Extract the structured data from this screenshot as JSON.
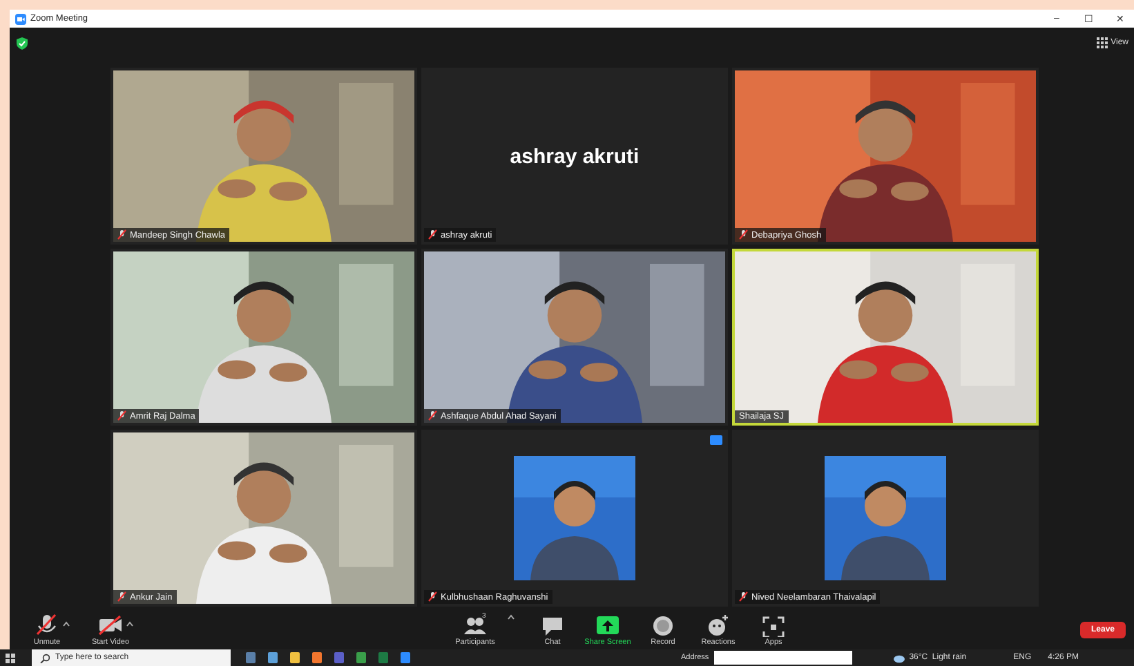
{
  "window": {
    "title": "Zoom Meeting",
    "controls": [
      "–",
      "☐",
      "✕"
    ]
  },
  "top_bar": {
    "view_label": "View"
  },
  "tiles": [
    {
      "kind": "video",
      "name": "Mandeep Singh Chawla",
      "muted": true,
      "speaking": false
    },
    {
      "kind": "name",
      "name": "ashray akruti",
      "display": "ashray akruti",
      "muted": true,
      "speaking": false
    },
    {
      "kind": "video",
      "name": "Debapriya Ghosh",
      "muted": true,
      "speaking": false
    },
    {
      "kind": "video",
      "name": "Amrit Raj Dalma",
      "muted": true,
      "speaking": false
    },
    {
      "kind": "video",
      "name": "Ashfaque Abdul Ahad Sayani",
      "muted": true,
      "speaking": false
    },
    {
      "kind": "video",
      "name": "Shailaja SJ",
      "muted": false,
      "speaking": true
    },
    {
      "kind": "video",
      "name": "Ankur Jain",
      "muted": true,
      "speaking": false
    },
    {
      "name": "Kulbhushaan Raghuvanshi",
      "muted": true,
      "speaking": false,
      "badge": true
    },
    {
      "name": "Nived Neelambaran Thaivalapil",
      "muted": true,
      "speaking": false
    }
  ],
  "toolbar": {
    "left": [
      {
        "kind": "mic",
        "label": "Unmute"
      },
      {
        "kind": "camera",
        "label": "Start Video"
      }
    ],
    "center": [
      {
        "kind": "participants",
        "label": "Participants",
        "count": "3",
        "selected": false
      },
      {
        "kind": "chat",
        "label": "Chat",
        "selected": false
      },
      {
        "kind": "share",
        "label": "Share Screen",
        "selected": true
      },
      {
        "kind": "record",
        "label": "Record",
        "selected": false
      },
      {
        "kind": "reactions",
        "label": "Reactions",
        "selected": false
      },
      {
        "kind": "apps",
        "label": "Apps",
        "selected": false
      }
    ],
    "leave": "Leave"
  },
  "taskbar": {
    "search_placeholder": "Type here to search",
    "apps": [
      {
        "kind": "calculator"
      },
      {
        "kind": "notepad"
      },
      {
        "kind": "folder"
      },
      {
        "kind": "firefox"
      },
      {
        "kind": "teams"
      },
      {
        "kind": "chrome"
      },
      {
        "kind": "excel"
      },
      {
        "kind": "zoom"
      }
    ],
    "address_label": "Address",
    "weather": "36°C  Light rain",
    "language": "ENG",
    "time": "4:26 PM"
  }
}
